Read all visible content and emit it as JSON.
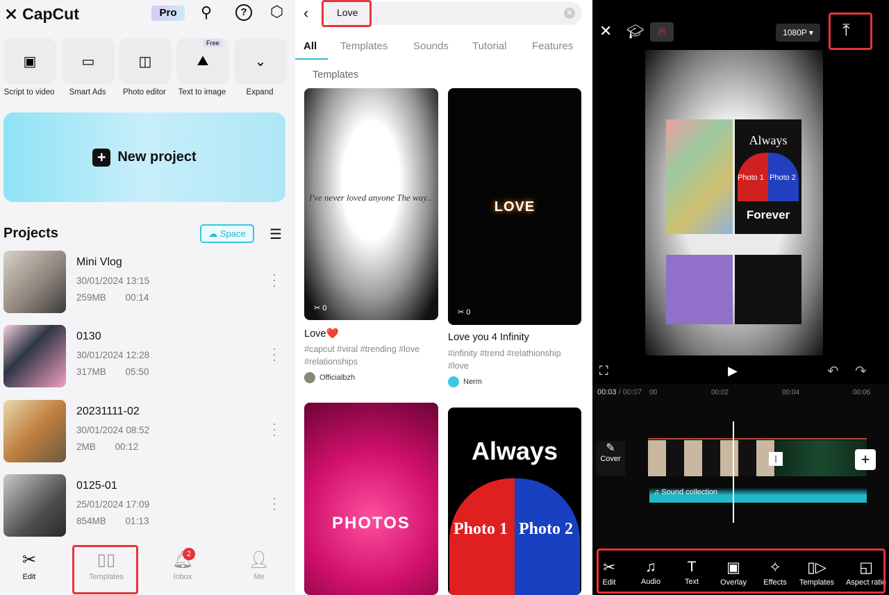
{
  "home": {
    "app_name": "CapCut",
    "pro_label": "Pro",
    "tools": [
      {
        "label": "Script to video",
        "icon": "script-to-video-icon"
      },
      {
        "label": "Smart Ads",
        "icon": "smart-ads-icon"
      },
      {
        "label": "Photo editor",
        "icon": "photo-editor-icon"
      },
      {
        "label": "Text to image",
        "icon": "text-to-image-icon",
        "badge": "Free"
      },
      {
        "label": "Expand",
        "icon": "chevron-down-icon"
      }
    ],
    "new_project": "New project",
    "projects_title": "Projects",
    "space_label": "Space",
    "projects": [
      {
        "name": "Mini Vlog",
        "date": "30/01/2024 13:15",
        "size": "259MB",
        "duration": "00:14"
      },
      {
        "name": "0130",
        "date": "30/01/2024 12:28",
        "size": "317MB",
        "duration": "05:50"
      },
      {
        "name": "20231111-02",
        "date": "30/01/2024 08:52",
        "size": "2MB",
        "duration": "00:12"
      },
      {
        "name": "0125-01",
        "date": "25/01/2024 17:09",
        "size": "854MB",
        "duration": "01:13"
      }
    ],
    "nav": [
      {
        "label": "Edit",
        "active": true
      },
      {
        "label": "Templates"
      },
      {
        "label": "Inbox",
        "badge": "2"
      },
      {
        "label": "Me"
      }
    ]
  },
  "search": {
    "query": "Love",
    "tabs": [
      "All",
      "Templates",
      "Sounds",
      "Tutorial",
      "Features"
    ],
    "active_tab": "All",
    "section": "Templates",
    "results": [
      {
        "title": "Love❤️",
        "tags": "#capcut #viral #trending #love #relationships",
        "author": "Officialbzh",
        "uses": "0",
        "preview_text": "I've never loved anyone The way..."
      },
      {
        "title": "Love you 4 Infinity",
        "tags": "#infinity #trend #relathionship #love",
        "author": "Nerm",
        "uses": "0",
        "preview_text": "LOVE"
      },
      {
        "preview_text": "PHOTOS"
      },
      {
        "preview_text": "Always",
        "photo1": "Photo 1",
        "photo2": "Photo 2"
      }
    ]
  },
  "editor": {
    "resolution": "1080P",
    "current_time": "00:03",
    "total_time": "00:07",
    "ruler": [
      "00",
      "00:02",
      "00:04",
      "00:06"
    ],
    "cover_label": "Cover",
    "audio_track": "Sound collection",
    "preview": {
      "always": "Always",
      "forever": "Forever",
      "photo1": "Photo 1",
      "photo2": "Photo 2"
    },
    "toolbar": [
      "Edit",
      "Audio",
      "Text",
      "Overlay",
      "Effects",
      "Templates",
      "Aspect ratio"
    ]
  },
  "colors": {
    "highlight": "#e6343a",
    "accent": "#20b8d0",
    "audio_wave": "#1fb8c8"
  }
}
